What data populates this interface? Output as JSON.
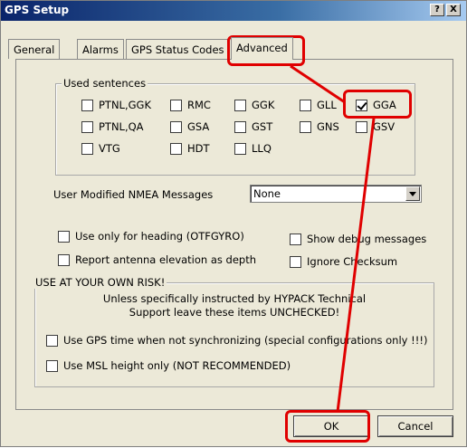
{
  "window": {
    "title": "GPS Setup",
    "help_btn": "?",
    "close_btn": "X"
  },
  "tabs": [
    {
      "label": "General"
    },
    {
      "label": "Alarms"
    },
    {
      "label": "GPS Status Codes"
    },
    {
      "label": "Advanced",
      "active": true
    }
  ],
  "used_sentences": {
    "legend": "Used sentences",
    "items": [
      {
        "label": "PTNL,GGK",
        "checked": false
      },
      {
        "label": "RMC",
        "checked": false
      },
      {
        "label": "GGK",
        "checked": false
      },
      {
        "label": "GLL",
        "checked": false
      },
      {
        "label": "GGA",
        "checked": true
      },
      {
        "label": "PTNL,QA",
        "checked": false
      },
      {
        "label": "GSA",
        "checked": false
      },
      {
        "label": "GST",
        "checked": false
      },
      {
        "label": "GNS",
        "checked": false
      },
      {
        "label": "GSV",
        "checked": false
      },
      {
        "label": "VTG",
        "checked": false
      },
      {
        "label": "HDT",
        "checked": false
      },
      {
        "label": "LLQ",
        "checked": false
      }
    ]
  },
  "nmea": {
    "label": "User Modified NMEA Messages",
    "value": "None"
  },
  "options": {
    "heading": "Use only for heading (OTFGYRO)",
    "debug": "Show debug messages",
    "elevation": "Report antenna elevation as depth",
    "checksum": "Ignore Checksum"
  },
  "risk": {
    "legend": "USE AT YOUR OWN RISK!",
    "warning_line1": "Unless specifically instructed by HYPACK Technical",
    "warning_line2": "Support leave these items UNCHECKED!",
    "gps_time": "Use GPS time when not synchronizing (special configurations only !!!)",
    "msl": "Use MSL height only (NOT RECOMMENDED)"
  },
  "buttons": {
    "ok": "OK",
    "cancel": "Cancel"
  },
  "colors": {
    "highlight": "#e00000",
    "titlebar": "#0a246a"
  }
}
